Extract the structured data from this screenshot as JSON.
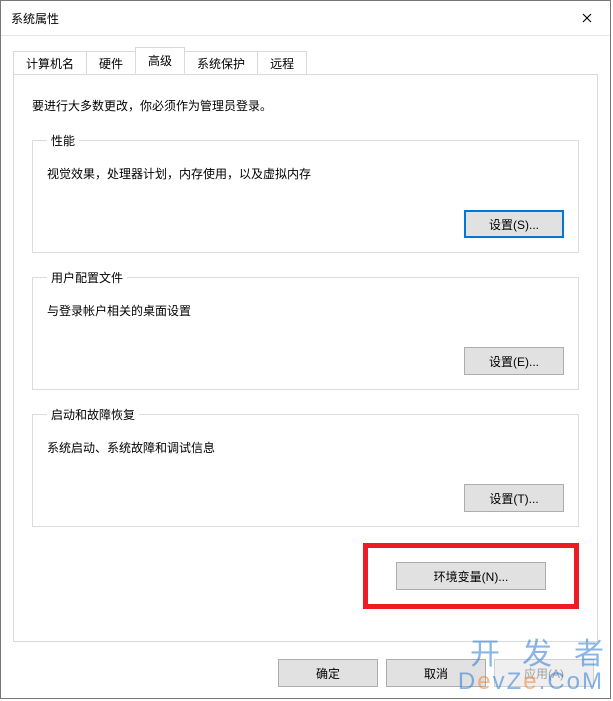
{
  "window": {
    "title": "系统属性"
  },
  "tabs": {
    "t0": "计算机名",
    "t1": "硬件",
    "t2": "高级",
    "t3": "系统保护",
    "t4": "远程"
  },
  "advanced": {
    "intro": "要进行大多数更改，你必须作为管理员登录。",
    "perf": {
      "legend": "性能",
      "desc": "视觉效果，处理器计划，内存使用，以及虚拟内存",
      "button": "设置(S)..."
    },
    "profiles": {
      "legend": "用户配置文件",
      "desc": "与登录帐户相关的桌面设置",
      "button": "设置(E)..."
    },
    "startup": {
      "legend": "启动和故障恢复",
      "desc": "系统启动、系统故障和调试信息",
      "button": "设置(T)..."
    },
    "env_button": "环境变量(N)..."
  },
  "footer": {
    "ok": "确定",
    "cancel": "取消",
    "apply": "应用(A)"
  },
  "watermark": {
    "line1": "开发者",
    "line2_prefix": "D",
    "line2_e1": "e",
    "line2_mid": "vZ",
    "line2_e2": "e",
    "line2_suffix": ".CoM"
  }
}
